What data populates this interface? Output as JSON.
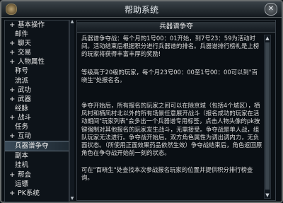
{
  "window": {
    "title": "帮助系统",
    "close_glyph": "✕"
  },
  "sidebar": {
    "items": [
      {
        "label": "基本操作",
        "expand": "+",
        "active": false
      },
      {
        "label": "邮件",
        "expand": "",
        "active": false
      },
      {
        "label": "聊天",
        "expand": "+",
        "active": false
      },
      {
        "label": "交易",
        "expand": "+",
        "active": false
      },
      {
        "label": "人物属性",
        "expand": "+",
        "active": false
      },
      {
        "label": "称号",
        "expand": "",
        "active": false
      },
      {
        "label": "流派",
        "expand": "",
        "active": false
      },
      {
        "label": "武功",
        "expand": "+",
        "active": false
      },
      {
        "label": "武器",
        "expand": "+",
        "active": false
      },
      {
        "label": "经脉",
        "expand": "",
        "active": false
      },
      {
        "label": "战斗",
        "expand": "+",
        "active": false
      },
      {
        "label": "任务",
        "expand": "",
        "active": false
      },
      {
        "label": "互动",
        "expand": "+",
        "active": false
      },
      {
        "label": "兵器谱争夺",
        "expand": "",
        "active": true
      },
      {
        "label": "副本",
        "expand": "",
        "active": false
      },
      {
        "label": "挂机",
        "expand": "",
        "active": false
      },
      {
        "label": "帮会",
        "expand": "+",
        "active": false
      },
      {
        "label": "运镖",
        "expand": "",
        "active": false
      },
      {
        "label": "PK系统",
        "expand": "+",
        "active": false
      }
    ]
  },
  "content": {
    "heading": "兵器谱争夺",
    "paragraphs": [
      "兵器谱争夺战：每个月的1号00：01开始，到7号23：59为活动时间。活动结束后根据积分进行兵器谱的排名。兵器谱排行榜礼是上榜的玩家将获得丰富丰厚的奖励!",
      "等级高于20级的玩家，每个月23号00：00至1号00：00可以到\"百晓生\"处报名名。",
      "争夺开始后，所有报名的玩家之间可以在除京城（包括4个城区），栖凤村和栖凤村北以外的所有场景任意展开战斗（报名成功的玩家在活动期间\"玩家列表\"会多出一个兵器谱专用标签，点击人物头像的pk按键强制对其他报名的玩家发生战斗，无需接受。争夺战是单人战，组队玩家无法进行。争夺战开始后，双方角色属性为调出调内力，无负面状态。（所使用正面效果药品依然生效）争夺战结束后，角色返回原角色在争夺战开始前一刻的状态。",
      "可在\"百晓生\"处查找本次参战报名玩家的位置并提供积分排行榜查询。"
    ]
  },
  "icons": {
    "scroll_up": "▲",
    "scroll_down": "▼"
  }
}
